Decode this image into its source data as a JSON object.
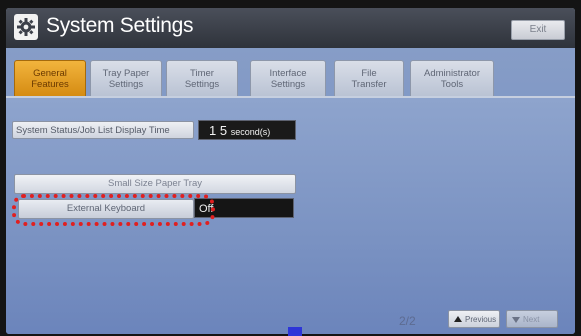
{
  "window": {
    "title": "System Settings",
    "exit_label": "Exit",
    "icon": "gear-icon"
  },
  "tabs": [
    {
      "label": "General Features",
      "line1": "General",
      "line2": "Features",
      "active": true
    },
    {
      "label": "Tray Paper Settings",
      "line1": "Tray Paper",
      "line2": "Settings",
      "active": false
    },
    {
      "label": "Timer Settings",
      "line1": "Timer",
      "line2": "Settings",
      "active": false
    },
    {
      "label": "Interface Settings",
      "line1": "Interface",
      "line2": "Settings",
      "active": false
    },
    {
      "label": "File Transfer",
      "line1": "File",
      "line2": "Transfer",
      "active": false
    },
    {
      "label": "Administrator Tools",
      "line1": "Administrator",
      "line2": "Tools",
      "active": false
    }
  ],
  "settings": {
    "status_display": {
      "label": "System Status/Job List Display Time",
      "value": "1 5",
      "unit": "second(s)"
    },
    "small_size_paper_tray": {
      "label": "Small Size Paper Tray"
    },
    "external_keyboard": {
      "label": "External Keyboard",
      "value": "Off"
    }
  },
  "pagination": {
    "page": "2/2",
    "previous_label": "Previous",
    "next_label": "Next"
  },
  "colors": {
    "active_tab": "#e09a1f",
    "highlight": "#e02020",
    "panel": "#7d95c4"
  }
}
